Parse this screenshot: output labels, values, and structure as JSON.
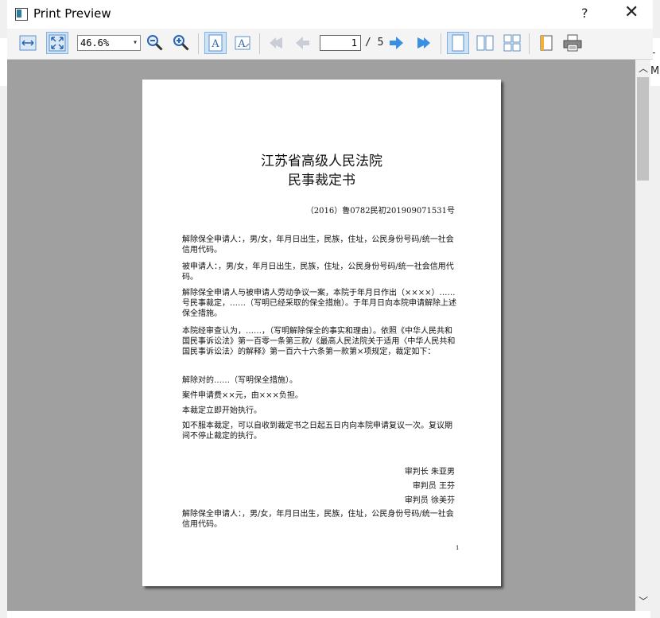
{
  "window": {
    "title": "Print Preview",
    "help_label": "?",
    "close_label": "✕"
  },
  "background": {
    "right_text_1": "ւ",
    "right_text_2": "M"
  },
  "toolbar": {
    "zoom_value": "46.6%",
    "current_page": "1",
    "page_total": "/ 5",
    "icons": [
      "fit-width-icon",
      "fit-page-icon",
      "zoom-out-icon",
      "zoom-in-icon",
      "portrait-icon",
      "landscape-icon",
      "first-page-icon",
      "previous-page-icon",
      "next-page-icon",
      "last-page-icon",
      "single-page-icon",
      "two-pages-icon",
      "all-pages-icon",
      "page-setup-icon",
      "print-icon"
    ]
  },
  "document": {
    "title_line1": "江苏省高级人民法院",
    "title_line2": "民事裁定书",
    "case_number": "（2016）鲁0782民初201909071531号",
    "paragraphs": [
      "解除保全申请人：，男/女，年月日出生，民族，住址，公民身份号码/统一社会信用代码。",
      "被申请人：，男/女，年月日出生，民族，住址，公民身份号码/统一社会信用代码。",
      "解除保全申请人与被申请人劳动争议一案，本院于年月日作出（××××）……号民事裁定，……（写明已经采取的保全措施）。于年月日向本院申请解除上述保全措施。",
      "本院经审查认为，……，（写明解除保全的事实和理由）。依照《中华人民共和国民事诉讼法》第一百零一条第三款/《最高人民法院关于适用〈中华人民共和国民事诉讼法〉的解释》第一百六十六条第一款第×项规定，裁定如下：",
      "解除对的……（写明保全措施）。",
      "案件申请费××元，由×××负担。",
      "本裁定立即开始执行。",
      "如不服本裁定，可以自收到裁定书之日起五日内向本院申请复议一次。复议期间不停止裁定的执行。"
    ],
    "signatures": [
      "审判长 朱亚男",
      "审判员 王芬",
      "审判员 徐美芬"
    ],
    "footer_paragraph": "解除保全申请人：，男/女，年月日出生，民族，住址，公民身份号码/统一社会信用代码。",
    "page_number": "1"
  }
}
